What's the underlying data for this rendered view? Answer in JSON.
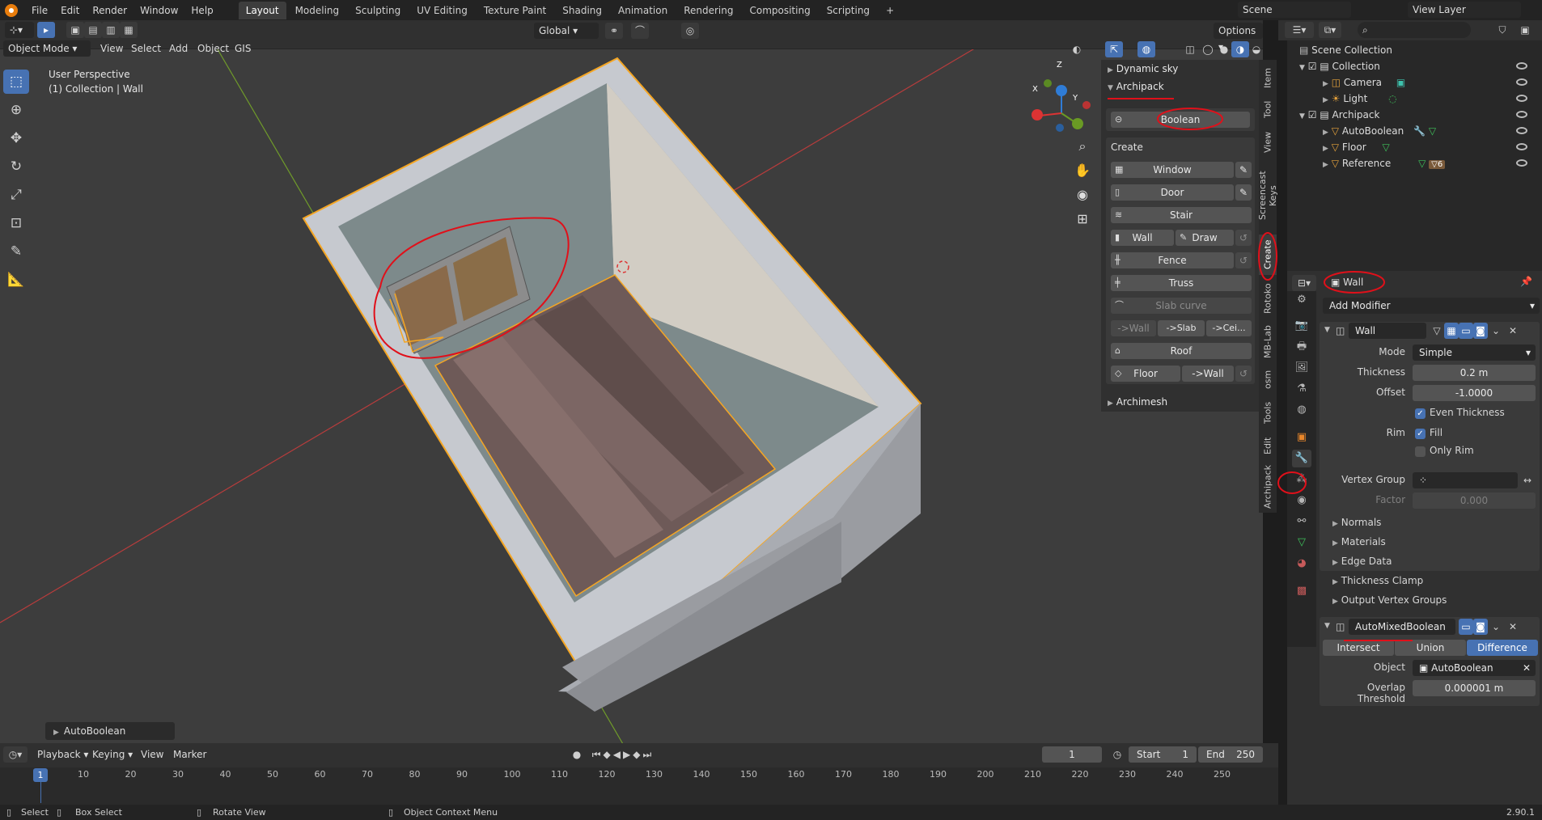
{
  "topbar": {
    "menus": [
      "File",
      "Edit",
      "Render",
      "Window",
      "Help"
    ],
    "workspaces": [
      "Layout",
      "Modeling",
      "Sculpting",
      "UV Editing",
      "Texture Paint",
      "Shading",
      "Animation",
      "Rendering",
      "Compositing",
      "Scripting"
    ],
    "active_workspace": "Layout",
    "add_label": "+",
    "scene": "Scene",
    "view_layer": "View Layer"
  },
  "viewport_header": {
    "orientation": "Global",
    "options": "Options",
    "mode": "Object Mode",
    "menus": [
      "View",
      "Select",
      "Add",
      "Object",
      "GIS"
    ]
  },
  "viewport": {
    "perspective": "User Perspective",
    "collection": "(1) Collection | Wall",
    "last_op": "AutoBoolean",
    "gizmo": {
      "x": "X",
      "y": "Y",
      "z": "Z"
    }
  },
  "npanel": {
    "dynamic_sky": "Dynamic sky",
    "archipack": "Archipack",
    "boolean": "Boolean",
    "create": "Create",
    "window": "Window",
    "door": "Door",
    "stair": "Stair",
    "wall": "Wall",
    "draw": "Draw",
    "fence": "Fence",
    "truss": "Truss",
    "slab_curve": "Slab curve",
    "to_wall": "->Wall",
    "to_slab": "->Slab",
    "to_ceil": "->Cei...",
    "roof": "Roof",
    "floor": "Floor",
    "floor_to_wall": "->Wall",
    "archimesh": "Archimesh",
    "tabs": [
      "Item",
      "Tool",
      "View",
      "Screencast Keys",
      "Create",
      "Rotoko",
      "MB-Lab",
      "osm",
      "Tools",
      "Edit",
      "Archipack"
    ],
    "active_tab": "Create"
  },
  "outliner": {
    "root": "Scene Collection",
    "items": [
      {
        "label": "Collection",
        "level": 1
      },
      {
        "label": "Camera",
        "level": 2
      },
      {
        "label": "Light",
        "level": 2
      },
      {
        "label": "Archipack",
        "level": 1
      },
      {
        "label": "AutoBoolean",
        "level": 2
      },
      {
        "label": "Floor",
        "level": 2
      },
      {
        "label": "Reference",
        "level": 2
      }
    ],
    "reference_badge": "6"
  },
  "properties": {
    "object_name": "Wall",
    "add_modifier": "Add Modifier",
    "mod1": {
      "name": "Wall",
      "mode_label": "Mode",
      "mode": "Simple",
      "thickness_label": "Thickness",
      "thickness": "0.2 m",
      "offset_label": "Offset",
      "offset": "-1.0000",
      "even_thickness": "Even Thickness",
      "rim_label": "Rim",
      "fill": "Fill",
      "only_rim": "Only Rim",
      "vgroup_label": "Vertex Group",
      "factor_label": "Factor",
      "factor": "0.000",
      "subpanels": [
        "Normals",
        "Materials",
        "Edge Data",
        "Thickness Clamp",
        "Output Vertex Groups"
      ]
    },
    "mod2": {
      "name": "AutoMixedBoolean",
      "ops": [
        "Intersect",
        "Union",
        "Difference"
      ],
      "active_op": "Difference",
      "object_label": "Object",
      "object": "AutoBoolean",
      "threshold_label": "Overlap Threshold",
      "threshold": "0.000001 m"
    }
  },
  "timeline": {
    "menus": [
      "Playback",
      "Keying",
      "View",
      "Marker"
    ],
    "current_frame": "1",
    "start_label": "Start",
    "start": "1",
    "end_label": "End",
    "end": "250",
    "ticks": [
      "10",
      "20",
      "30",
      "40",
      "50",
      "60",
      "70",
      "80",
      "90",
      "100",
      "110",
      "120",
      "130",
      "140",
      "150",
      "160",
      "170",
      "180",
      "190",
      "200",
      "210",
      "220",
      "230",
      "240",
      "250"
    ],
    "cursor_label": "1"
  },
  "status": {
    "select": "Select",
    "box_select": "Box Select",
    "rotate": "Rotate View",
    "context_menu": "Object Context Menu",
    "version": "2.90.1"
  },
  "colors": {
    "accent": "#4772b3",
    "selection": "#f5a623",
    "annotation": "#e0101a"
  }
}
